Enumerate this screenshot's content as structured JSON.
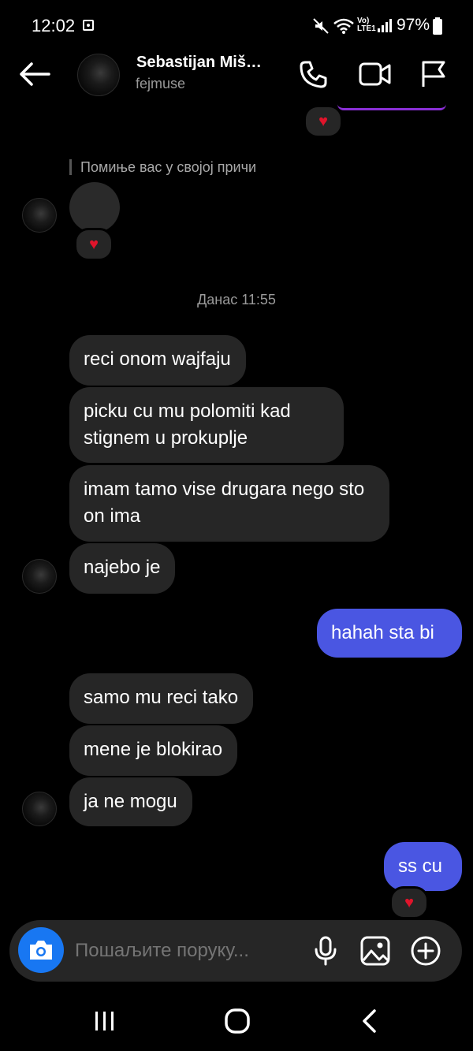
{
  "status_bar": {
    "time": "12:02",
    "battery": "97%",
    "network": "LTE1"
  },
  "header": {
    "contact_name": "Sebastijan Miš…",
    "username": "fejmuse"
  },
  "story_mention": {
    "text": "Помиње вас у својој причи"
  },
  "timestamp": "Данас 11:55",
  "messages": [
    {
      "from": "them",
      "text": "reci onom wajfaju"
    },
    {
      "from": "them",
      "text": "picku cu mu polomiti kad stignem u prokuplje"
    },
    {
      "from": "them",
      "text": "imam tamo vise drugara nego sto on ima"
    },
    {
      "from": "them",
      "text": "najebo je"
    },
    {
      "from": "me",
      "text": "hahah sta bi"
    },
    {
      "from": "them",
      "text": "samo mu reci tako"
    },
    {
      "from": "them",
      "text": "mene je blokirao"
    },
    {
      "from": "them",
      "text": "ja ne mogu"
    },
    {
      "from": "me",
      "text": "ss cu"
    }
  ],
  "reactions": {
    "emoji": "♥"
  },
  "composer": {
    "placeholder": "Пошаљите поруку..."
  },
  "colors": {
    "background": "#000000",
    "incoming_bubble": "#262626",
    "outgoing_bubble": "#4a56e2",
    "camera_button": "#1877f2",
    "reaction_heart": "#e0142b"
  }
}
